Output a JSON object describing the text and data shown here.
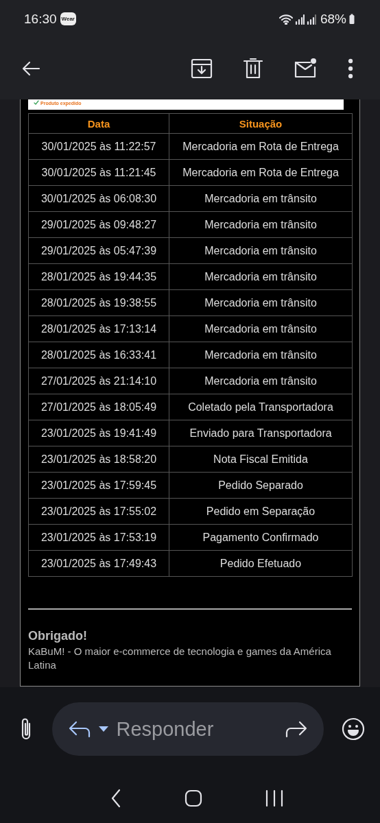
{
  "status_bar": {
    "time": "16:30",
    "badge": "Wear",
    "battery": "68%"
  },
  "email": {
    "banner": {
      "text": "Produto expedido"
    },
    "table": {
      "columns": [
        "Data",
        "Situação"
      ],
      "rows": [
        [
          "30/01/2025 às 11:22:57",
          "Mercadoria em Rota de Entrega"
        ],
        [
          "30/01/2025 às 11:21:45",
          "Mercadoria em Rota de Entrega"
        ],
        [
          "30/01/2025 às 06:08:30",
          "Mercadoria em trânsito"
        ],
        [
          "29/01/2025 às 09:48:27",
          "Mercadoria em trânsito"
        ],
        [
          "29/01/2025 às 05:47:39",
          "Mercadoria em trânsito"
        ],
        [
          "28/01/2025 às 19:44:35",
          "Mercadoria em trânsito"
        ],
        [
          "28/01/2025 às 19:38:55",
          "Mercadoria em trânsito"
        ],
        [
          "28/01/2025 às 17:13:14",
          "Mercadoria em trânsito"
        ],
        [
          "28/01/2025 às 16:33:41",
          "Mercadoria em trânsito"
        ],
        [
          "27/01/2025 às 21:14:10",
          "Mercadoria em trânsito"
        ],
        [
          "27/01/2025 às 18:05:49",
          "Coletado pela Transportadora"
        ],
        [
          "23/01/2025 às 19:41:49",
          "Enviado para Transportadora"
        ],
        [
          "23/01/2025 às 18:58:20",
          "Nota Fiscal Emitida"
        ],
        [
          "23/01/2025 às 17:59:45",
          "Pedido Separado"
        ],
        [
          "23/01/2025 às 17:55:02",
          "Pedido em Separação"
        ],
        [
          "23/01/2025 às 17:53:19",
          "Pagamento Confirmado"
        ],
        [
          "23/01/2025 às 17:49:43",
          "Pedido Efetuado"
        ]
      ]
    },
    "thanks": "Obrigado!",
    "tagline": "KaBuM! - O maior e-commerce de tecnologia e games da América Latina"
  },
  "reply_bar": {
    "placeholder": "Responder"
  }
}
